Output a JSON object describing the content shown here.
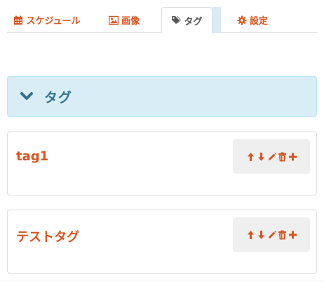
{
  "tabs": [
    {
      "label": "スケジュール",
      "icon": "calendar-icon",
      "active": false
    },
    {
      "label": "画像",
      "icon": "image-icon",
      "active": false
    },
    {
      "label": "タグ",
      "icon": "tags-icon",
      "active": true
    },
    {
      "label": "設定",
      "icon": "gear-icon",
      "active": false
    }
  ],
  "panel": {
    "title": "タグ",
    "icon": "chevron-down-icon"
  },
  "tags": [
    {
      "name": "tag1"
    },
    {
      "name": "テストタグ"
    }
  ],
  "actions": [
    "arrow-up-icon",
    "arrow-down-icon",
    "pencil-icon",
    "trash-icon",
    "plus-icon"
  ],
  "colors": {
    "accent": "#d9541e",
    "panel_bg": "#d9edf7",
    "panel_text": "#31708f",
    "actions_bg": "#efefef"
  }
}
